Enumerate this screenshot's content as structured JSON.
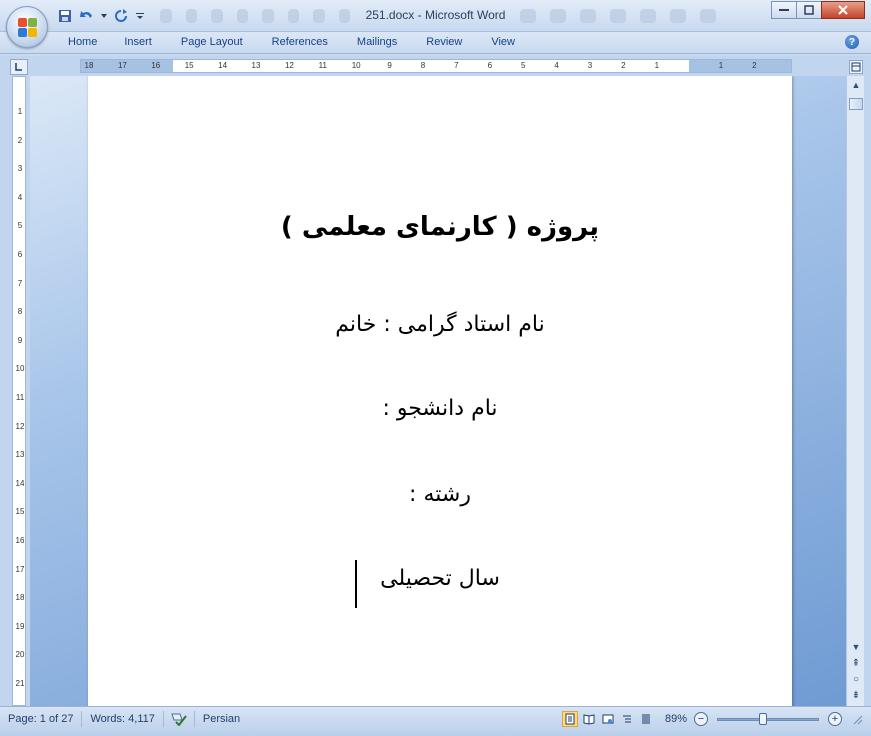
{
  "window": {
    "title": "251.docx - Microsoft Word"
  },
  "ribbon": {
    "tabs": [
      "Home",
      "Insert",
      "Page Layout",
      "References",
      "Mailings",
      "Review",
      "View"
    ]
  },
  "ruler": {
    "h_numbers": [
      "18",
      "17",
      "16",
      "15",
      "14",
      "13",
      "12",
      "11",
      "10",
      "9",
      "8",
      "7",
      "6",
      "5",
      "4",
      "3",
      "2",
      "1",
      "1",
      "2"
    ],
    "v_numbers": [
      "1",
      "2",
      "3",
      "4",
      "5",
      "6",
      "7",
      "8",
      "9",
      "10",
      "11",
      "12",
      "13",
      "14",
      "15",
      "16",
      "17",
      "18",
      "19",
      "20",
      "21"
    ]
  },
  "document": {
    "lines": [
      "پروژه ( کارنمای معلمی )",
      "نام استاد گرامی : خانم",
      "نام دانشجو :",
      "رشته :",
      "سال تحصیلی"
    ]
  },
  "status": {
    "page": "Page: 1 of 27",
    "words": "Words: 4,117",
    "language": "Persian",
    "zoom": "89%",
    "zoom_level_percent": 89
  },
  "colors": {
    "accent": "#15428b",
    "workspace": "#6f9bd3"
  }
}
